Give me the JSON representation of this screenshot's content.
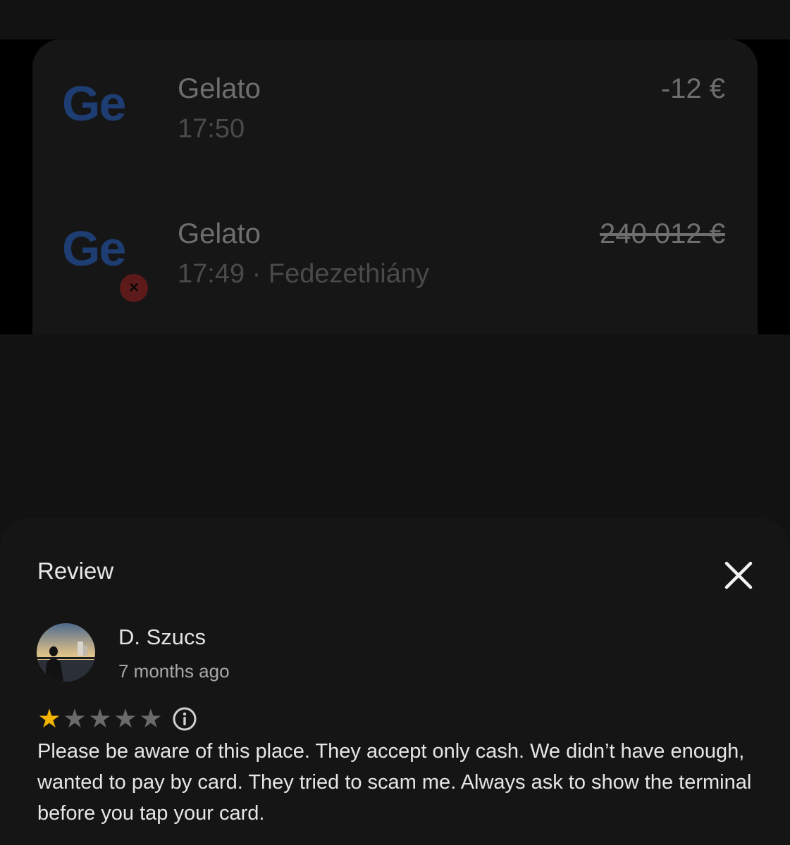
{
  "transactions": [
    {
      "logo": "Ge",
      "merchant": "Gelato",
      "meta": "17:50",
      "amount": "-12 €",
      "struck": false,
      "failed": false
    },
    {
      "logo": "Ge",
      "merchant": "Gelato",
      "meta": "17:49 · Fedezethiány",
      "amount": "240 012 €",
      "struck": true,
      "failed": true,
      "fail_icon": "×"
    }
  ],
  "review_sheet": {
    "title": "Review",
    "close_icon": "close-icon",
    "reviewer": {
      "name": "D. Szucs",
      "time": "7 months ago"
    },
    "rating": {
      "value": 1,
      "max": 5,
      "star_glyph": "★",
      "info_icon": "info-icon"
    },
    "text": "Please be aware of this place. They accept only cash. We didn’t have enough, wanted to pay by card. They tried to scam me. Always ask to show the terminal before you tap your card."
  },
  "colors": {
    "star_active": "#f2b400",
    "star_inactive": "#6a6a6a",
    "logo_blue": "#1e3d73",
    "fail_red": "#5c1a1a"
  }
}
